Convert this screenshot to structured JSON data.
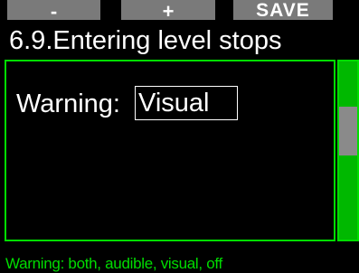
{
  "softkeys": {
    "minus_label": "-",
    "plus_label": "+",
    "save_label": "SAVE"
  },
  "title": "6.9.Entering level stops",
  "setting": {
    "label": "Warning:",
    "value": "Visual"
  },
  "help_text": "Warning: both, audible, visual, off",
  "colors": {
    "accent": "#00dd00",
    "softkey_bg": "#7a7a7a",
    "background": "#000000"
  }
}
